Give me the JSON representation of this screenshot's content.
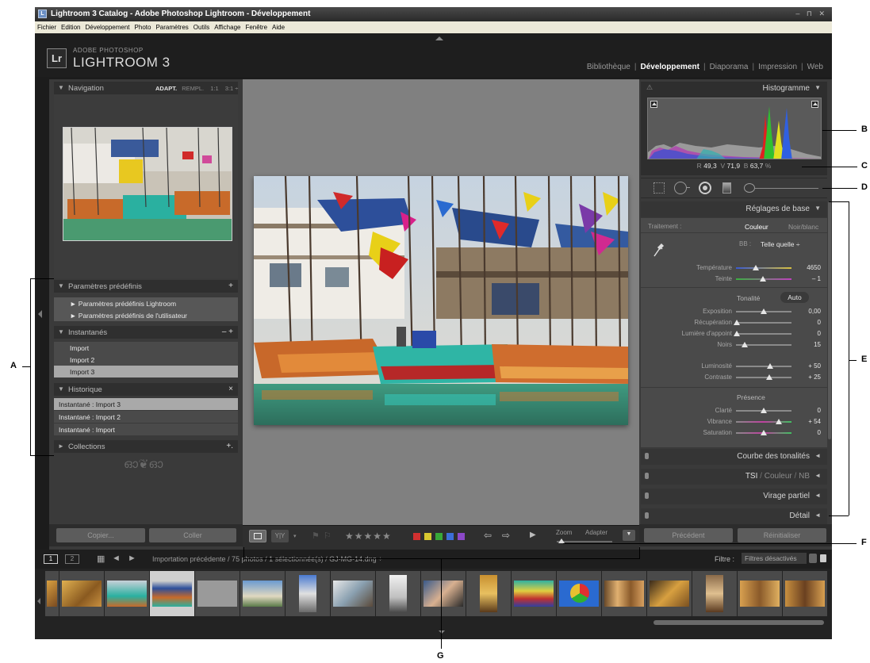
{
  "window": {
    "title": "Lightroom 3 Catalog - Adobe Photoshop Lightroom - Développement",
    "controls": "– ⊓ ✕"
  },
  "menu": [
    "Fichier",
    "Edition",
    "Développement",
    "Photo",
    "Paramètres",
    "Outils",
    "Affichage",
    "Fenêtre",
    "Aide"
  ],
  "identity": {
    "logo": "Lr",
    "line1": "ADOBE PHOTOSHOP",
    "line2": "LIGHTROOM 3"
  },
  "modules": [
    {
      "label": "Bibliothèque",
      "active": false
    },
    {
      "label": "Développement",
      "active": true
    },
    {
      "label": "Diaporama",
      "active": false
    },
    {
      "label": "Impression",
      "active": false
    },
    {
      "label": "Web",
      "active": false
    }
  ],
  "left": {
    "navigation": {
      "title": "Navigation",
      "zoom_options": [
        "ADAPT.",
        "REMPL.",
        "1:1",
        "3:1 ÷"
      ]
    },
    "presets": {
      "title": "Paramètres prédéfinis",
      "add": "+",
      "items": [
        "Paramètres prédéfinis Lightroom",
        "Paramètres prédéfinis de l'utilisateur"
      ]
    },
    "snapshots": {
      "title": "Instantanés",
      "actions": "–  +",
      "items": [
        "Import",
        "Import 2",
        "Import 3"
      ],
      "selected": 2
    },
    "history": {
      "title": "Historique",
      "action": "×",
      "items": [
        "Instantané : Import 3",
        "Instantané : Import 2",
        "Instantané : Import"
      ],
      "selected": 0
    },
    "collections": {
      "title": "Collections",
      "add": "+."
    },
    "copy_button": "Copier...",
    "paste_button": "Coller"
  },
  "right": {
    "histogram": {
      "title": "Histogramme",
      "readout": {
        "r_label": "R",
        "r_value": "49,3",
        "v_label": "V",
        "v_value": "71,9",
        "b_label": "B",
        "b_value": "63,7",
        "unit": "%"
      }
    },
    "basic": {
      "title": "Réglages de base",
      "treatment_label": "Traitement :",
      "treatment_color": "Couleur",
      "treatment_bw": "Noir/blanc",
      "wb_label": "BB :",
      "wb_value": "Telle quelle ÷",
      "temperature": {
        "label": "Température",
        "value": "4650",
        "level": 0.35
      },
      "tint": {
        "label": "Teinte",
        "value": "– 1",
        "level": 0.49
      },
      "tone_label": "Tonalité",
      "auto_label": "Auto",
      "exposure": {
        "label": "Exposition",
        "value": "0,00",
        "level": 0.5
      },
      "recovery": {
        "label": "Récupération",
        "value": "0",
        "level": 0.02
      },
      "fill_light": {
        "label": "Lumière d'appoint",
        "value": "0",
        "level": 0.02
      },
      "blacks": {
        "label": "Noirs",
        "value": "15",
        "level": 0.15
      },
      "brightness": {
        "label": "Luminosité",
        "value": "+ 50",
        "level": 0.62
      },
      "contrast": {
        "label": "Contraste",
        "value": "+ 25",
        "level": 0.6
      },
      "presence_label": "Présence",
      "clarity": {
        "label": "Clarté",
        "value": "0",
        "level": 0.5
      },
      "vibrance": {
        "label": "Vibrance",
        "value": "+ 54",
        "level": 0.77
      },
      "saturation": {
        "label": "Saturation",
        "value": "0",
        "level": 0.5
      }
    },
    "tone_curve": "Courbe des tonalités",
    "hsl": {
      "a": "TSI",
      "sep1": "/",
      "b": "Couleur",
      "sep2": "/",
      "c": "NB"
    },
    "split_toning": "Virage partiel",
    "detail": "Détail",
    "previous_button": "Précédent",
    "reset_button": "Réinitialiser"
  },
  "toolbar": {
    "stars": "★★★★★",
    "zoom_label": "Zoom",
    "zoom_value": "Adapter",
    "color_labels": [
      "#d03030",
      "#d8c830",
      "#38a838",
      "#3c6ed8",
      "#8c48c8"
    ]
  },
  "filmstrip": {
    "page1": "1",
    "page2": "2",
    "path": "Importation précédente / 75 photos / 1 sélectionnée(s) / GJ-MG-14.dng ÷",
    "filter_label": "Filtre :",
    "filter_value": "Filtres désactivés"
  },
  "callouts": [
    "A",
    "B",
    "C",
    "D",
    "E",
    "F",
    "G"
  ]
}
